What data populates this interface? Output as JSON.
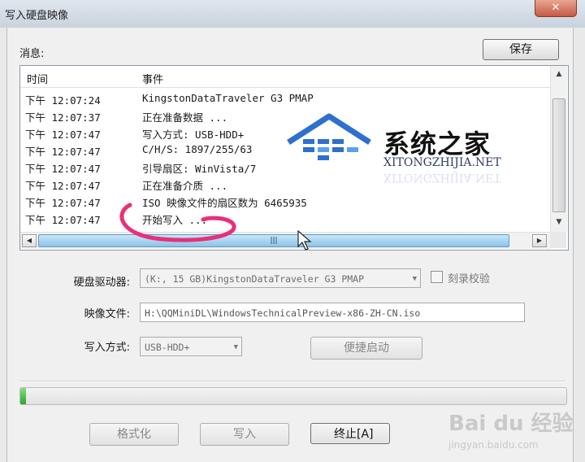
{
  "window": {
    "title": "写入硬盘映像",
    "close_glyph": "✕"
  },
  "messages": {
    "label": "消息:",
    "save_label": "保存",
    "columns": [
      "时间",
      "事件"
    ],
    "rows": [
      {
        "time": "下午 12:07:24",
        "event": "KingstonDataTraveler G3 PMAP"
      },
      {
        "time": "下午 12:07:37",
        "event": "正在准备数据 ..."
      },
      {
        "time": "下午 12:07:47",
        "event": "写入方式: USB-HDD+"
      },
      {
        "time": "下午 12:07:47",
        "event": "C/H/S: 1897/255/63"
      },
      {
        "time": "下午 12:07:47",
        "event": "引导扇区: WinVista/7"
      },
      {
        "time": "下午 12:07:47",
        "event": "正在准备介质 ..."
      },
      {
        "time": "下午 12:07:47",
        "event": "ISO 映像文件的扇区数为 6465935"
      },
      {
        "time": "下午 12:07:47",
        "event": "开始写入 ..."
      }
    ]
  },
  "form": {
    "drive_label": "硬盘驱动器:",
    "drive_value": "(K:, 15 GB)KingstonDataTraveler G3 PMAP",
    "verify_label": "刻录校验",
    "image_label": "映像文件:",
    "image_value": "H:\\QQMiniDL\\WindowsTechnicalPreview-x86-ZH-CN.iso",
    "method_label": "写入方式:",
    "method_value": "USB-HDD+",
    "quick_boot_label": "便捷启动"
  },
  "progress": {
    "fraction": 0.01
  },
  "buttons": {
    "format": "格式化",
    "write": "写入",
    "abort": "终止[A]"
  },
  "watermarks": {
    "brand": "系统之家",
    "brand_url": "XITONGZHIJIA.NET",
    "baidu": "Bai du 经验",
    "baidu_url": "jingyan.baidu.com"
  },
  "colors": {
    "accent": "#2ea32e",
    "annotation": "#e8307a",
    "watermark_blue": "#2e6fd0"
  }
}
